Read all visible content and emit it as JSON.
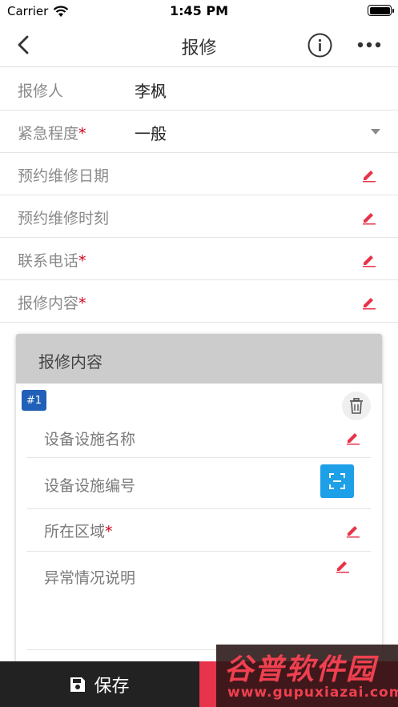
{
  "status_bar": {
    "carrier": "Carrier",
    "time": "1:45 PM"
  },
  "nav": {
    "title": "报修",
    "icons": [
      "back-chevron",
      "info-circle",
      "more-dots"
    ]
  },
  "form": {
    "reporter_label": "报修人",
    "reporter_value": "李枫",
    "urgency_label": "紧急程度",
    "urgency_value": "一般",
    "appt_date_label": "预约维修日期",
    "appt_time_label": "预约维修时刻",
    "phone_label": "联系电话",
    "content_label": "报修内容",
    "required_mark": "*"
  },
  "content_card": {
    "title": "报修内容",
    "badge": "#1",
    "fields": {
      "facility_name": "设备设施名称",
      "facility_code": "设备设施编号",
      "area": "所在区域",
      "abnormal": "异常情况说明"
    }
  },
  "bottom": {
    "save_label": "保存"
  },
  "watermark": {
    "main": "谷普软件园",
    "sub": "www.gupuxiazai.com"
  },
  "colors": {
    "accent_red": "#e8334a",
    "required": "#d0021b",
    "scan_blue": "#1ea0e8",
    "badge_blue": "#2060b8",
    "dark": "#222222"
  }
}
